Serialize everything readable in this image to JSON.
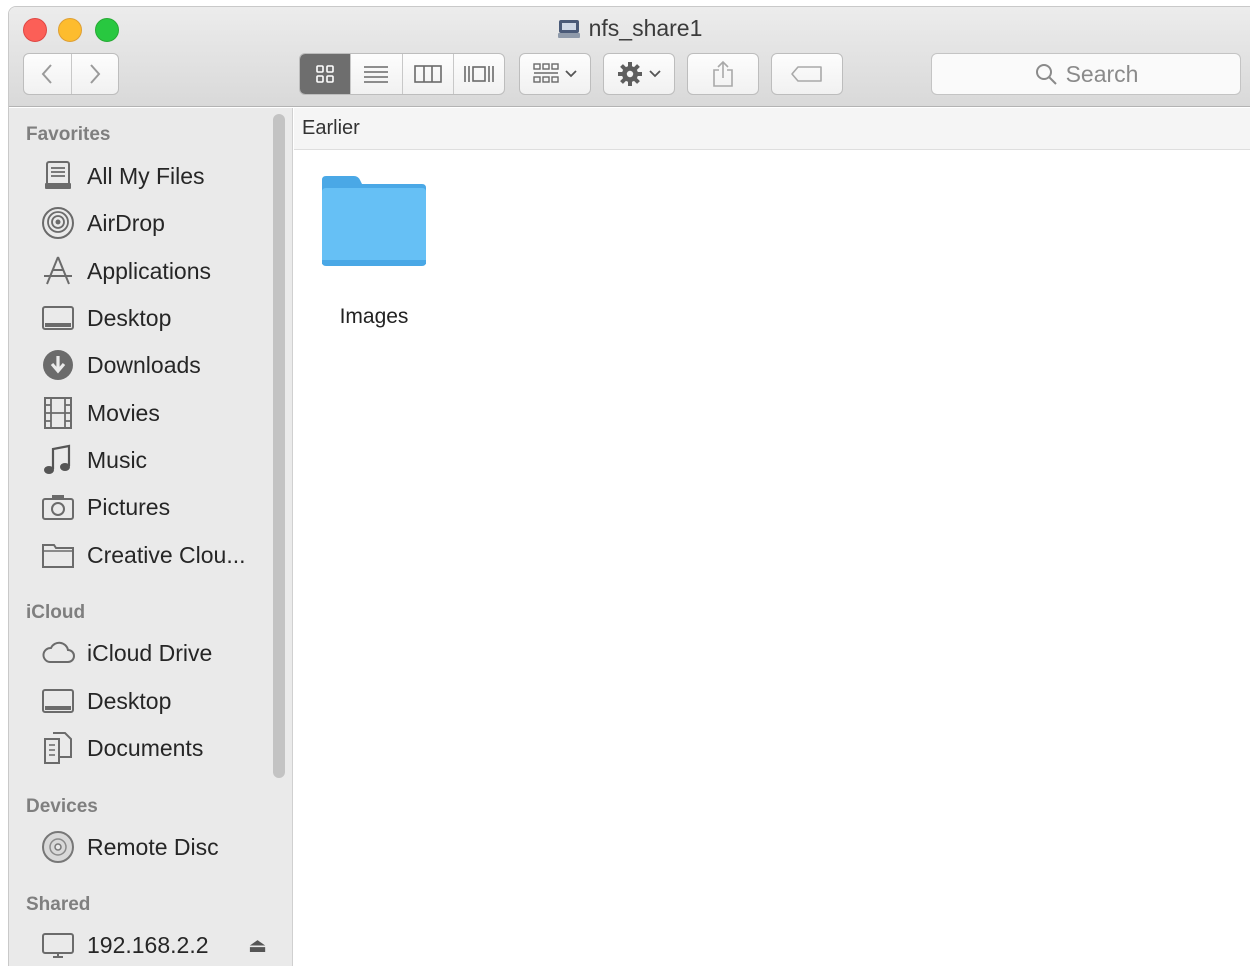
{
  "window": {
    "title": "nfs_share1"
  },
  "toolbar": {
    "back_icon": "chevron-left-icon",
    "forward_icon": "chevron-right-icon",
    "views": [
      "icon-view-icon",
      "list-view-icon",
      "column-view-icon",
      "cover-flow-icon"
    ],
    "arrange_icon": "arrange-icon",
    "action_icon": "gear-icon",
    "share_icon": "share-icon",
    "tag_icon": "tag-icon",
    "search_placeholder": "Search"
  },
  "sidebar": {
    "favorites_title": "Favorites",
    "favorites": [
      {
        "label": "All My Files",
        "icon": "all-my-files-icon"
      },
      {
        "label": "AirDrop",
        "icon": "airdrop-icon"
      },
      {
        "label": "Applications",
        "icon": "applications-icon"
      },
      {
        "label": "Desktop",
        "icon": "desktop-icon"
      },
      {
        "label": "Downloads",
        "icon": "downloads-icon"
      },
      {
        "label": "Movies",
        "icon": "movies-icon"
      },
      {
        "label": "Music",
        "icon": "music-icon"
      },
      {
        "label": "Pictures",
        "icon": "pictures-icon"
      },
      {
        "label": "Creative Clou...",
        "icon": "folder-icon"
      }
    ],
    "icloud_title": "iCloud",
    "icloud": [
      {
        "label": "iCloud Drive",
        "icon": "cloud-icon"
      },
      {
        "label": "Desktop",
        "icon": "desktop-icon"
      },
      {
        "label": "Documents",
        "icon": "documents-icon"
      }
    ],
    "devices_title": "Devices",
    "devices": [
      {
        "label": "Remote Disc",
        "icon": "disc-icon"
      }
    ],
    "shared_title": "Shared",
    "shared": [
      {
        "label": "192.168.2.2",
        "icon": "server-icon",
        "eject": "⏏"
      }
    ]
  },
  "main": {
    "group_header": "Earlier",
    "items": [
      {
        "name": "Images",
        "icon": "folder-icon"
      }
    ]
  },
  "colors": {
    "folder": "#5ab8f2",
    "toolbar": "#e3e3e3",
    "sidebar": "#eaeaea"
  }
}
